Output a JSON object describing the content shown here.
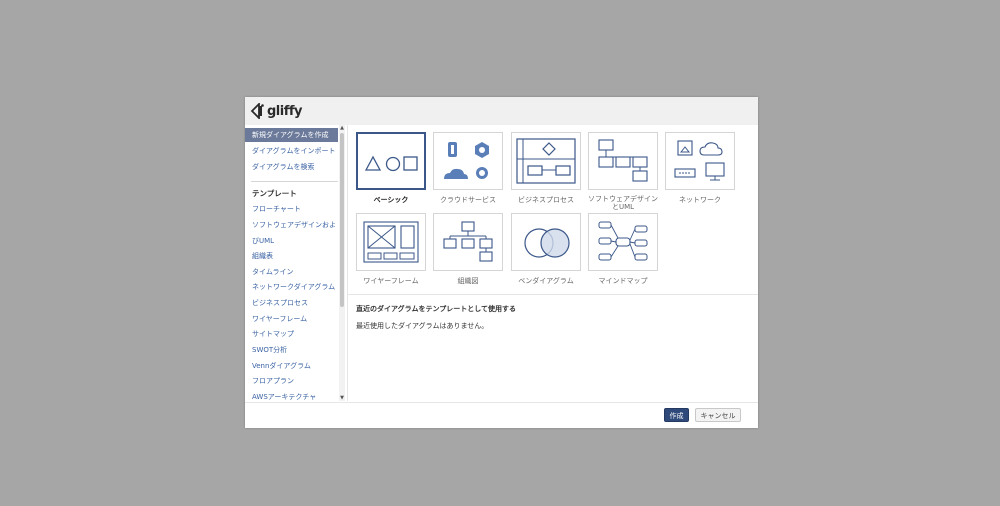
{
  "app": {
    "logo_text": "gliffy"
  },
  "sidebar": {
    "actions": [
      {
        "label": "新規ダイアグラムを作成",
        "active": true
      },
      {
        "label": "ダイアグラムをインポート",
        "active": false
      },
      {
        "label": "ダイアグラムを検索",
        "active": false
      }
    ],
    "templates_heading": "テンプレート",
    "templates": [
      "フローチャート",
      "ソフトウェアデザインおよ",
      "びUML",
      "組織表",
      "タイムライン",
      "ネットワークダイアグラム",
      "ビジネスプロセス",
      "ワイヤーフレーム",
      "サイトマップ",
      "SWOT分析",
      "Vennダイアグラム",
      "フロアプラン",
      "AWSアーキテクチャ"
    ]
  },
  "templates": [
    {
      "label": "ベーシック",
      "icon": "basic-shapes-icon",
      "selected": true
    },
    {
      "label": "クラウドサービス",
      "icon": "cloud-services-icon",
      "selected": false
    },
    {
      "label": "ビジネスプロセス",
      "icon": "business-process-icon",
      "selected": false
    },
    {
      "label": "ソフトウェアデザイン\nとUML",
      "icon": "uml-icon",
      "selected": false
    },
    {
      "label": "ネットワーク",
      "icon": "network-icon",
      "selected": false
    },
    {
      "label": "ワイヤーフレーム",
      "icon": "wireframe-icon",
      "selected": false
    },
    {
      "label": "組織図",
      "icon": "org-chart-icon",
      "selected": false
    },
    {
      "label": "ベンダイアグラム",
      "icon": "venn-diagram-icon",
      "selected": false
    },
    {
      "label": "マインドマップ",
      "icon": "mind-map-icon",
      "selected": false
    }
  ],
  "recent": {
    "title": "直近のダイアグラムをテンプレートとして使用する",
    "empty_message": "最近使用したダイアグラムはありません。"
  },
  "buttons": {
    "create": "作成",
    "cancel": "キャンセル"
  },
  "colors": {
    "accent": "#3b5789",
    "primary_button": "#2f4a7a",
    "link": "#3a62a3",
    "overlay": "#a6a6a6"
  }
}
